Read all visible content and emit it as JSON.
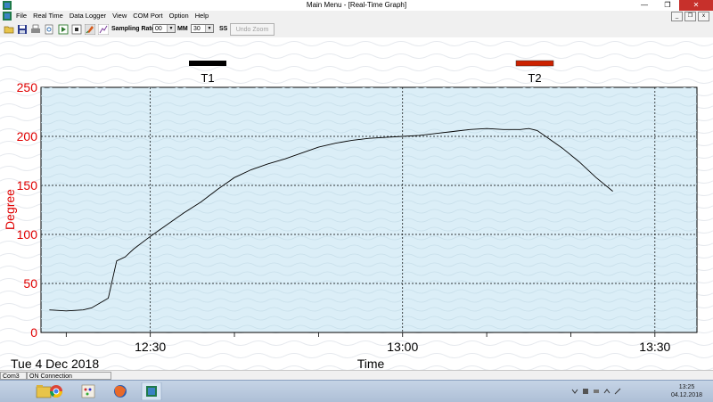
{
  "window": {
    "title": "Main Menu - [Real-Time Graph]",
    "controls": [
      "minimize",
      "maximize",
      "close"
    ]
  },
  "menu": {
    "items": [
      "File",
      "Real Time",
      "Data Logger",
      "View",
      "COM Port",
      "Option",
      "Help"
    ]
  },
  "toolbar": {
    "sampling_label": "Sampling Rate",
    "mm_value": "00",
    "mm_label": "MM",
    "ss_value": "30",
    "ss_label": "SS",
    "undo_zoom": "Undo Zoom"
  },
  "graph": {
    "legend": [
      {
        "name": "T1",
        "color": "#000000"
      },
      {
        "name": "T2",
        "color": "#cc2200"
      }
    ],
    "date_label": "Tue 4 Dec 2018",
    "plot_bg": "#dbeef7"
  },
  "chart_data": {
    "type": "line",
    "xlabel": "Time",
    "ylabel": "Degree",
    "ylim": [
      0,
      250
    ],
    "y_ticks": [
      0,
      50,
      100,
      150,
      200,
      250
    ],
    "x_ticks": [
      "12:30",
      "13:00",
      "13:30"
    ],
    "x_range": [
      "12:17",
      "13:35"
    ],
    "grid": true,
    "legend_position": "top",
    "series": [
      {
        "name": "T1",
        "color": "#000000",
        "x": [
          "12:18",
          "12:20",
          "12:22",
          "12:23",
          "12:24",
          "12:25",
          "12:26",
          "12:27",
          "12:28",
          "12:30",
          "12:32",
          "12:34",
          "12:36",
          "12:38",
          "12:40",
          "12:42",
          "12:44",
          "12:46",
          "12:48",
          "12:50",
          "12:52",
          "12:54",
          "12:56",
          "12:58",
          "13:00",
          "13:02",
          "13:04",
          "13:06",
          "13:08",
          "13:10",
          "13:12",
          "13:14",
          "13:15",
          "13:16",
          "13:17",
          "13:19",
          "13:21",
          "13:23",
          "13:25"
        ],
        "values": [
          23,
          22,
          23,
          25,
          30,
          35,
          73,
          77,
          85,
          98,
          110,
          122,
          133,
          146,
          158,
          166,
          172,
          177,
          183,
          189,
          193,
          196,
          198,
          199,
          200,
          201,
          203,
          205,
          207,
          208,
          207,
          207,
          208,
          206,
          200,
          188,
          174,
          158,
          144
        ]
      }
    ]
  },
  "status": {
    "port": "Com3",
    "connection": "ON Connection"
  },
  "taskbar": {
    "apps": [
      "explorer-icon",
      "chrome-icon",
      "paint-icon",
      "firefox-icon",
      "logger-app-icon"
    ],
    "time": "13:25",
    "date": "04.12.2018"
  }
}
